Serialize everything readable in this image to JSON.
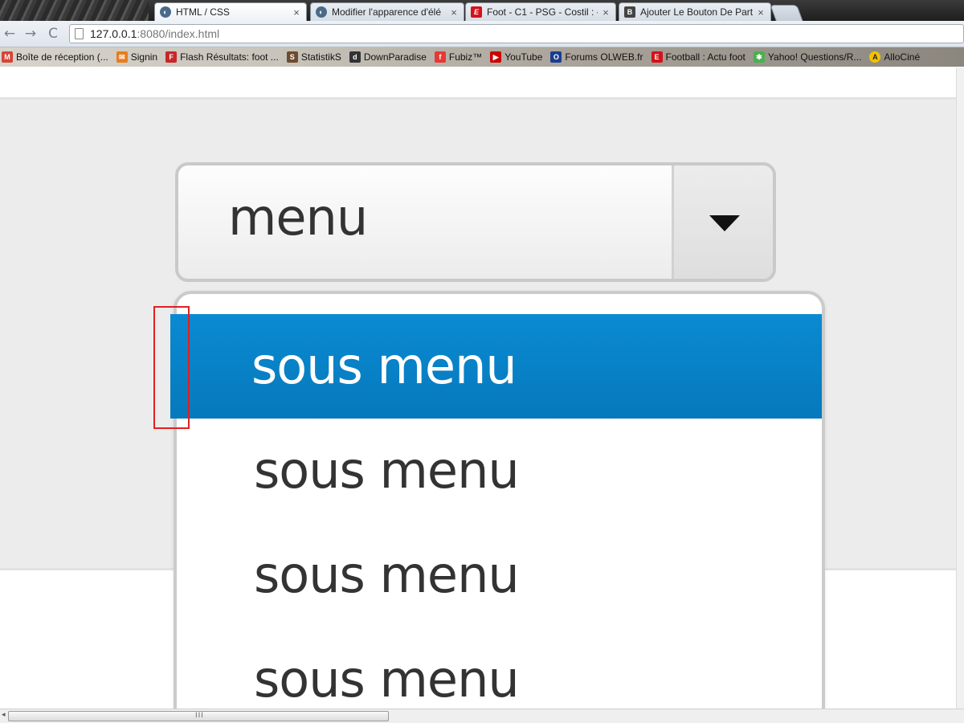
{
  "browser": {
    "tabs": [
      {
        "title": "HTML / CSS",
        "favicon": "openclassrooms-icon",
        "active": true
      },
      {
        "title": "Modifier l'apparence d'élé",
        "favicon": "openclassrooms-icon",
        "active": false
      },
      {
        "title": "Foot - C1 - PSG - Costil : «",
        "favicon": "lequipe-icon",
        "active": false
      },
      {
        "title": "Ajouter Le Bouton De Part",
        "favicon": "blogger-icon",
        "active": false
      }
    ],
    "close_glyph": "×",
    "url_host": "127.0.0.1",
    "url_rest": ":8080/index.html",
    "nav": {
      "back": "←",
      "forward": "→",
      "reload": "C"
    },
    "bookmarks": [
      {
        "label": "Boîte de réception (...",
        "icon": "gmail-icon",
        "color": "#d44638"
      },
      {
        "label": "Signin",
        "icon": "envelope-icon",
        "color": "#e87d1e"
      },
      {
        "label": "Flash Résultats: foot ...",
        "icon": "flashscore-icon",
        "color": "#c62828"
      },
      {
        "label": "StatistikS",
        "icon": "statistiks-icon",
        "color": "#6d4c2f"
      },
      {
        "label": "DownParadise",
        "icon": "downparadise-icon",
        "color": "#333333"
      },
      {
        "label": "Fubiz™",
        "icon": "fubiz-icon",
        "color": "#e53935"
      },
      {
        "label": "YouTube",
        "icon": "youtube-icon",
        "color": "#cc0000"
      },
      {
        "label": "Forums OLWEB.fr",
        "icon": "olweb-icon",
        "color": "#1a3d8f"
      },
      {
        "label": "Football : Actu foot",
        "icon": "lequipe-icon",
        "color": "#d4121a"
      },
      {
        "label": "Yahoo! Questions/R...",
        "icon": "yahoo-answers-icon",
        "color": "#4caf50"
      },
      {
        "label": "AlloCiné",
        "icon": "allocine-icon",
        "color": "#f2c200"
      }
    ]
  },
  "select": {
    "label": "menu"
  },
  "dropdown": {
    "options": [
      {
        "label": "sous menu",
        "selected": true
      },
      {
        "label": "sous menu",
        "selected": false
      },
      {
        "label": "sous menu",
        "selected": false
      },
      {
        "label": "sous menu",
        "selected": false
      }
    ]
  },
  "colors": {
    "selected_option": "#0a84cc",
    "annotation_box": "#e02020",
    "page_band": "#ececec"
  }
}
